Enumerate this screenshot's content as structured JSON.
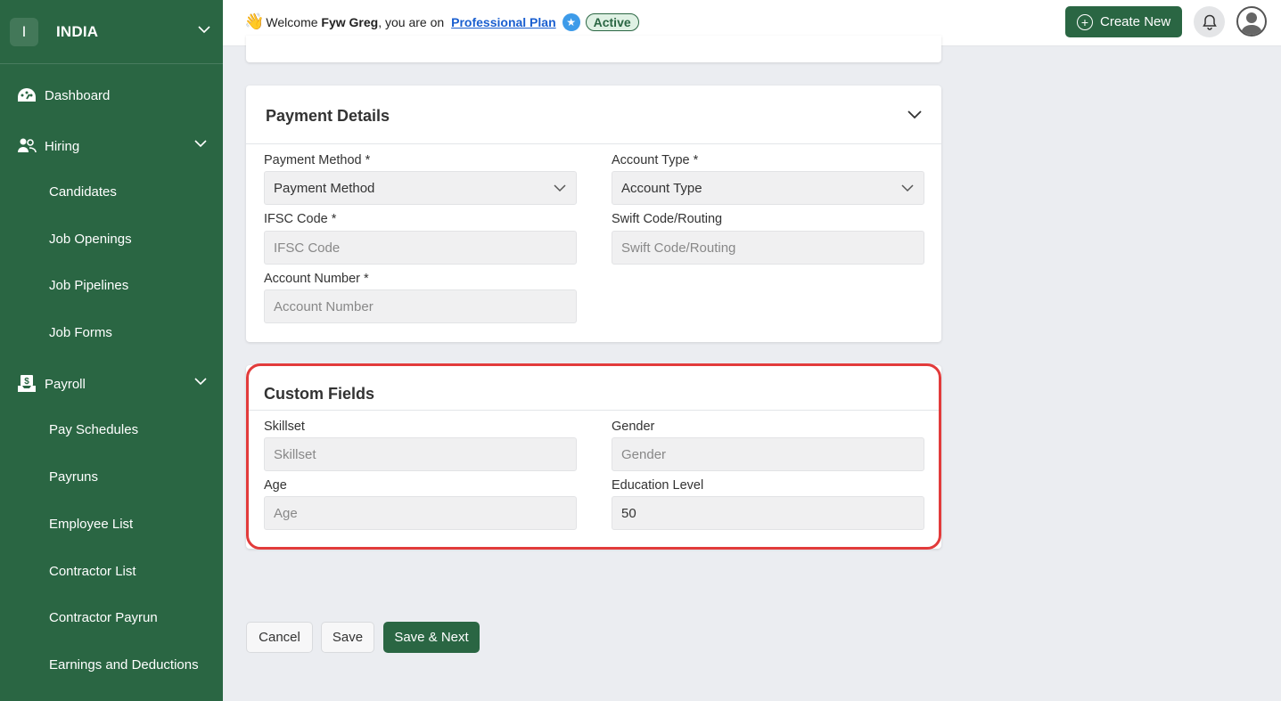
{
  "org": {
    "initial": "I",
    "name": "INDIA"
  },
  "nav": {
    "dashboard": "Dashboard",
    "hiring": "Hiring",
    "hiring_items": [
      "Candidates",
      "Job Openings",
      "Job Pipelines",
      "Job Forms"
    ],
    "payroll": "Payroll",
    "payroll_items": [
      "Pay Schedules",
      "Payruns",
      "Employee List",
      "Contractor List",
      "Contractor Payrun",
      "Earnings and Deductions"
    ]
  },
  "header": {
    "wave": "👋",
    "welcome_prefix": "Welcome",
    "user": "Fyw Greg",
    "welcome_suffix": ", you are on",
    "plan": "Professional Plan",
    "status": "Active",
    "create_label": "Create New"
  },
  "payment": {
    "title": "Payment Details",
    "payment_method": {
      "label": "Payment Method *",
      "value": "Payment Method"
    },
    "account_type": {
      "label": "Account Type *",
      "value": "Account Type"
    },
    "ifsc": {
      "label": "IFSC Code *",
      "placeholder": "IFSC Code"
    },
    "swift": {
      "label": "Swift Code/Routing",
      "placeholder": "Swift Code/Routing"
    },
    "account_number": {
      "label": "Account Number *",
      "placeholder": "Account Number"
    }
  },
  "custom": {
    "title": "Custom Fields",
    "skillset": {
      "label": "Skillset",
      "placeholder": "Skillset"
    },
    "gender": {
      "label": "Gender",
      "placeholder": "Gender"
    },
    "age": {
      "label": "Age",
      "placeholder": "Age"
    },
    "education": {
      "label": "Education Level",
      "value": "50"
    }
  },
  "actions": {
    "cancel": "Cancel",
    "save": "Save",
    "save_next": "Save & Next"
  },
  "colors": {
    "sidebar": "#2a6643",
    "primary": "#2a6643",
    "highlight": "#e23b3b",
    "link": "#1a5fd0"
  }
}
